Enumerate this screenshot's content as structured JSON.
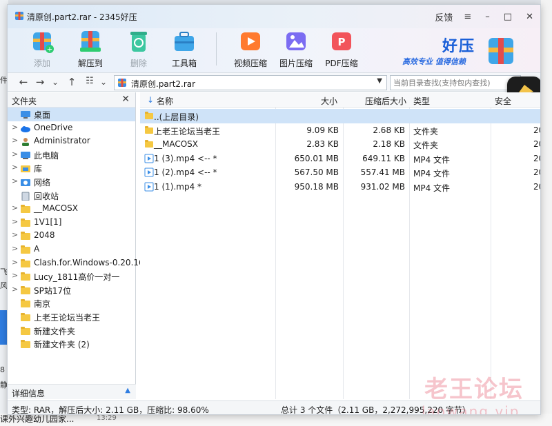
{
  "window": {
    "title": "清原创.part2.rar - 2345好压",
    "controls": {
      "feedback": "反馈",
      "menu": "≡",
      "minimize": "–",
      "maximize": "□",
      "close": "✕"
    }
  },
  "toolbar": {
    "add": "添加",
    "extract_to": "解压到",
    "delete": "删除",
    "toolbox": "工具箱",
    "video_compress": "视频压缩",
    "image_compress": "图片压缩",
    "pdf_compress": "PDF压缩"
  },
  "brand": {
    "name": "好压",
    "slogan": "高效专业  值得信赖"
  },
  "addressbar": {
    "back": "←",
    "forward": "→",
    "dropdown": "⌄",
    "up": "↑",
    "view": "☷",
    "view_dropdown": "⌄",
    "path": "清原创.part2.rar",
    "search_placeholder": "当前目录查找(支持包内查找)"
  },
  "tree": {
    "header": "文件夹",
    "footer": "详细信息",
    "items": [
      {
        "label": "桌面",
        "type": "desktop",
        "selected": true,
        "expand": ""
      },
      {
        "label": "OneDrive",
        "type": "cloud",
        "expand": ">"
      },
      {
        "label": "Administrator",
        "type": "user",
        "expand": ">"
      },
      {
        "label": "此电脑",
        "type": "pc",
        "expand": ">"
      },
      {
        "label": "库",
        "type": "library",
        "expand": ">"
      },
      {
        "label": "网络",
        "type": "network",
        "expand": ">"
      },
      {
        "label": "回收站",
        "type": "recycle",
        "expand": ""
      },
      {
        "label": "__MACOSX",
        "type": "folder",
        "expand": ">"
      },
      {
        "label": "1V1[1]",
        "type": "folder",
        "expand": ">"
      },
      {
        "label": "2048",
        "type": "folder",
        "expand": ">"
      },
      {
        "label": "A",
        "type": "folder",
        "expand": ">"
      },
      {
        "label": "Clash.for.Windows-0.20.16",
        "type": "folder",
        "expand": ">"
      },
      {
        "label": "Lucy_1811高价一对一",
        "type": "folder",
        "expand": ">"
      },
      {
        "label": "SP站17位",
        "type": "folder",
        "expand": ">"
      },
      {
        "label": "南京",
        "type": "folder",
        "expand": ""
      },
      {
        "label": "上老王论坛当老王",
        "type": "folder",
        "expand": ""
      },
      {
        "label": "新建文件夹",
        "type": "folder",
        "expand": ""
      },
      {
        "label": "新建文件夹 (2)",
        "type": "folder",
        "expand": ""
      }
    ]
  },
  "list": {
    "headers": {
      "name": "名称",
      "size": "大小",
      "packed": "压缩后大小",
      "type": "类型",
      "security": "安全"
    },
    "sort_arrow": "↓",
    "rows": [
      {
        "name": "..(上层目录)",
        "size": "",
        "packed": "",
        "type": "",
        "extra": "",
        "icon": "folder"
      },
      {
        "name": "上老王论坛当老王",
        "size": "9.09 KB",
        "packed": "2.68 KB",
        "type": "文件夹",
        "extra": "20",
        "icon": "folder"
      },
      {
        "name": "__MACOSX",
        "size": "2.83 KB",
        "packed": "2.18 KB",
        "type": "文件夹",
        "extra": "20",
        "icon": "folder"
      },
      {
        "name": "1 (3).mp4 <-- *",
        "size": "650.01 MB",
        "packed": "649.11 KB",
        "type": "MP4 文件",
        "extra": "20",
        "icon": "video"
      },
      {
        "name": "1 (2).mp4 <-- *",
        "size": "567.50 MB",
        "packed": "557.41 MB",
        "type": "MP4 文件",
        "extra": "20",
        "icon": "video"
      },
      {
        "name": "1 (1).mp4 *",
        "size": "950.18 MB",
        "packed": "931.02 MB",
        "type": "MP4 文件",
        "extra": "20",
        "icon": "video"
      }
    ]
  },
  "status": {
    "left": "类型: RAR，解压后大小: 2.11 GB，压缩比: 98.60%",
    "right": "总计 3 个文件（2.11 GB，2,272,995,220 字节）"
  },
  "watermark": {
    "line1": "老王论坛",
    "line2": "laowang.vip"
  },
  "background": {
    "bottom_text": "课外兴趣幼儿园家...",
    "bottom_time": "13:29",
    "left_glyphs": [
      "件",
      "飞",
      "风",
      "书",
      "8",
      "静"
    ]
  },
  "colors": {
    "accent": "#2f7de1",
    "selected": "#cfe3f8",
    "folder": "#f5c842"
  }
}
